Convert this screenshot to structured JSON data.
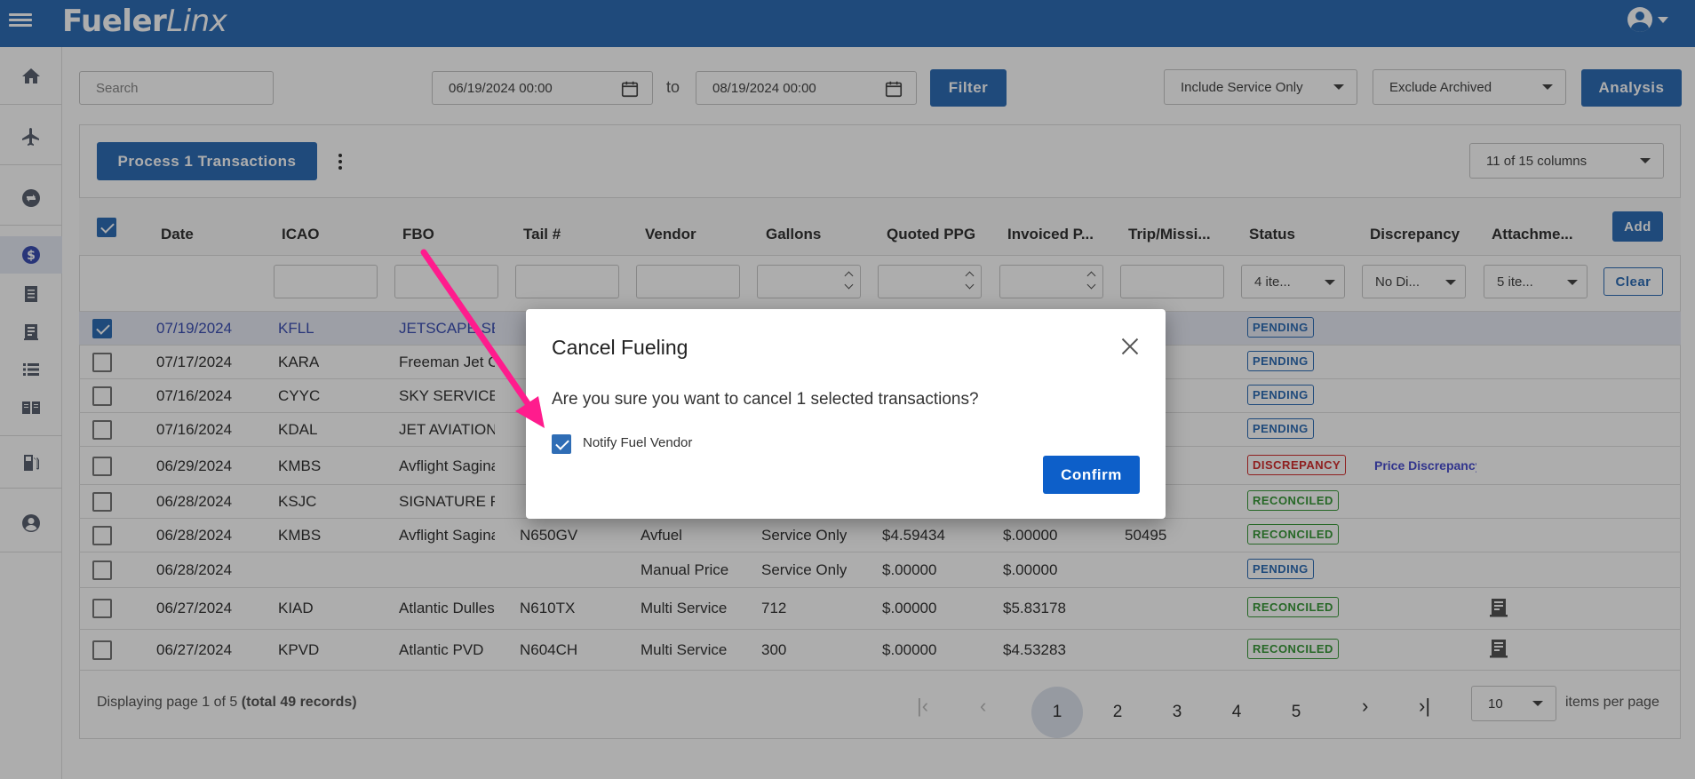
{
  "app": {
    "brand": "Fueler",
    "brand_italic": "Linx"
  },
  "toolbar": {
    "search_placeholder": "Search",
    "date_from": "06/19/2024 00:00",
    "date_to": "08/19/2024 00:00",
    "to_label": "to",
    "filter_label": "Filter",
    "service_filter": "Include Service Only",
    "archive_filter": "Exclude Archived",
    "analysis_label": "Analysis"
  },
  "grid": {
    "process_label": "Process 1 Transactions",
    "columns_select": "11 of 15 columns",
    "headers": [
      "Date",
      "ICAO",
      "FBO",
      "Tail #",
      "Vendor",
      "Gallons",
      "Quoted PPG",
      "Invoiced P...",
      "Trip/Missi...",
      "Status",
      "Discrepancy",
      "Attachme..."
    ],
    "add_label": "Add",
    "clear_label": "Clear",
    "filters": {
      "status": "4 ite...",
      "discrepancy": "No Di...",
      "attachments": "5 ite..."
    },
    "rows": [
      {
        "date": "07/19/2024",
        "icao": "KFLL",
        "fbo": "JETSCAPE SERVICES",
        "tail": "",
        "vendor": "",
        "gallons": "",
        "quoted": "",
        "invoiced": "",
        "trip": "",
        "status": "PENDING",
        "discrepancy": ""
      },
      {
        "date": "07/17/2024",
        "icao": "KARA",
        "fbo": "Freeman Jet Center",
        "tail": "",
        "vendor": "",
        "gallons": "",
        "quoted": "",
        "invoiced": "",
        "trip": "",
        "status": "PENDING",
        "discrepancy": ""
      },
      {
        "date": "07/16/2024",
        "icao": "CYYC",
        "fbo": "SKY SERVICE FBO",
        "tail": "",
        "vendor": "",
        "gallons": "",
        "quoted": "",
        "invoiced": "",
        "trip": "",
        "status": "PENDING",
        "discrepancy": ""
      },
      {
        "date": "07/16/2024",
        "icao": "KDAL",
        "fbo": "JET AVIATION",
        "tail": "",
        "vendor": "",
        "gallons": "",
        "quoted": "",
        "invoiced": "",
        "trip": "",
        "status": "PENDING",
        "discrepancy": ""
      },
      {
        "date": "06/29/2024",
        "icao": "KMBS",
        "fbo": "Avflight Saginaw",
        "tail": "",
        "vendor": "",
        "gallons": "",
        "quoted": "",
        "invoiced": "",
        "trip": "",
        "status": "DISCREPANCY",
        "discrepancy": "Price Discrepancy"
      },
      {
        "date": "06/28/2024",
        "icao": "KSJC",
        "fbo": "SIGNATURE FLIGHT",
        "tail": "",
        "vendor": "",
        "gallons": "",
        "quoted": "",
        "invoiced": "",
        "trip": "",
        "status": "RECONCILED",
        "discrepancy": ""
      },
      {
        "date": "06/28/2024",
        "icao": "KMBS",
        "fbo": "Avflight Saginaw",
        "tail": "N650GV",
        "vendor": "Avfuel",
        "gallons": "Service Only",
        "quoted": "$4.59434",
        "invoiced": "$.00000",
        "trip": "50495",
        "status": "RECONCILED",
        "discrepancy": ""
      },
      {
        "date": "06/28/2024",
        "icao": "",
        "fbo": "",
        "tail": "",
        "vendor": "Manual Price",
        "gallons": "Service Only",
        "quoted": "$.00000",
        "invoiced": "$.00000",
        "trip": "",
        "status": "PENDING",
        "discrepancy": ""
      },
      {
        "date": "06/27/2024",
        "icao": "KIAD",
        "fbo": "Atlantic Dulles",
        "tail": "N610TX",
        "vendor": "Multi Service",
        "gallons": "712",
        "quoted": "$.00000",
        "invoiced": "$5.83178",
        "trip": "",
        "status": "RECONCILED",
        "discrepancy": ""
      },
      {
        "date": "06/27/2024",
        "icao": "KPVD",
        "fbo": "Atlantic PVD",
        "tail": "N604CH",
        "vendor": "Multi Service",
        "gallons": "300",
        "quoted": "$.00000",
        "invoiced": "$4.53283",
        "trip": "",
        "status": "RECONCILED",
        "discrepancy": ""
      }
    ]
  },
  "pager": {
    "display_text": "Displaying page 1 of 5 ",
    "total_text": "(total 49 records)",
    "pages": [
      "1",
      "2",
      "3",
      "4",
      "5"
    ],
    "current_page": "1",
    "per_page": "10",
    "per_page_label": "items per page"
  },
  "modal": {
    "title": "Cancel Fueling",
    "message": "Are you sure you want to cancel 1 selected transactions?",
    "notify_label": "Notify Fuel Vendor",
    "notify_checked": true,
    "confirm_label": "Confirm"
  },
  "colors": {
    "primary": "#2f6db5",
    "confirm": "#0d5fc9",
    "pending": "#2f6db5",
    "reconciled": "#3a9a3a",
    "discrepancy": "#d32f2f",
    "annotation_arrow": "#ff1c8d"
  }
}
